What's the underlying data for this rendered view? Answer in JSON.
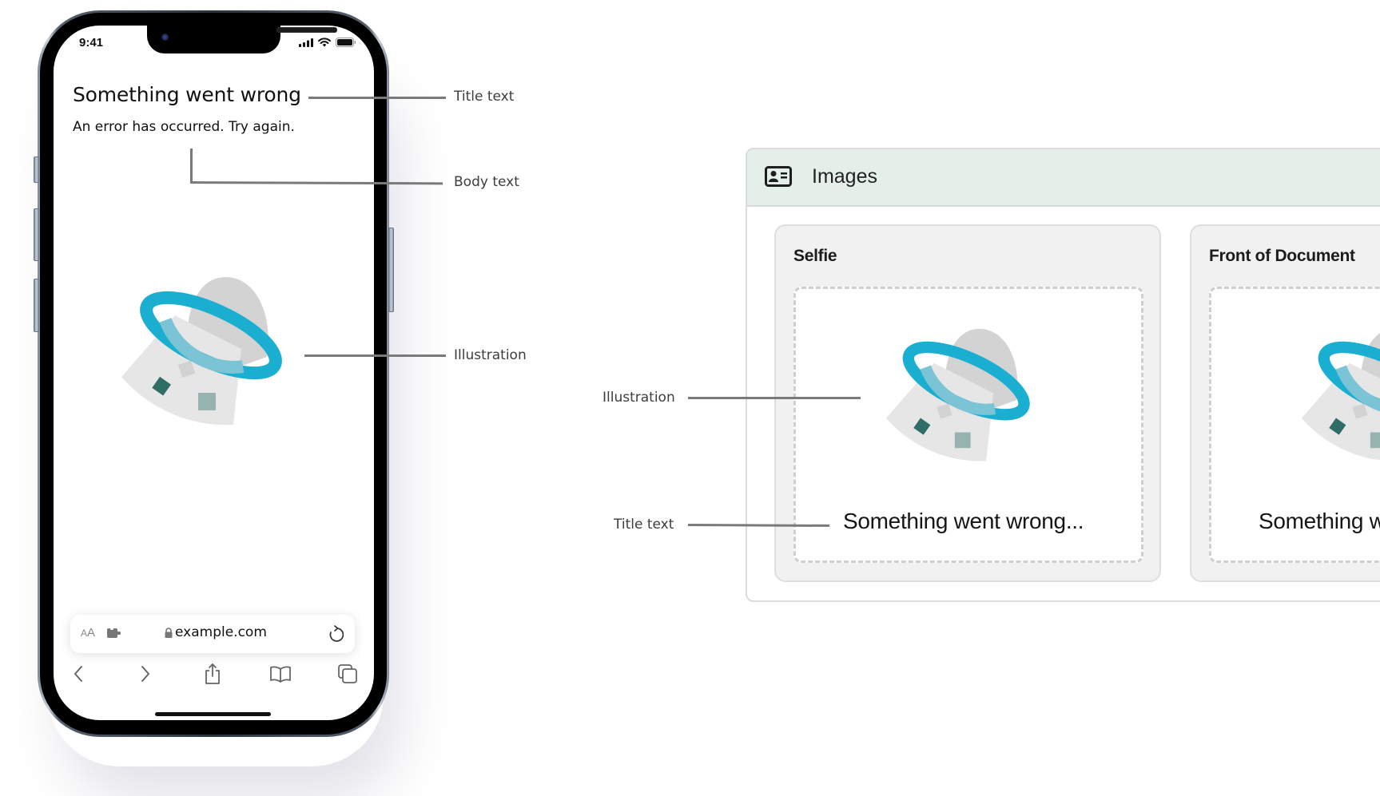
{
  "phone": {
    "status_bar": {
      "time": "9:41",
      "icons": [
        "cellular-signal-icon",
        "wifi-icon",
        "battery-icon"
      ]
    },
    "content": {
      "title": "Something went wrong",
      "body": "An error has occurred. Try again.",
      "illustration": "ufo-error-illustration"
    },
    "browser": {
      "text_size_label_small": "A",
      "text_size_label_large": "A",
      "url": "example.com",
      "toolbar": [
        "back",
        "forward",
        "share",
        "bookmarks",
        "tabs"
      ]
    }
  },
  "phone_annotations": {
    "title": "Title text",
    "body": "Body text",
    "illustration": "Illustration"
  },
  "panel": {
    "title": "Images",
    "cards": [
      {
        "title": "Selfie",
        "message": "Something went wrong..."
      },
      {
        "title": "Front of Document",
        "message": "Something went wrong..."
      }
    ]
  },
  "panel_annotations": {
    "illustration": "Illustration",
    "title": "Title text"
  },
  "colors": {
    "accent_ring": "#1aafd0",
    "header_bg": "#e3efe8",
    "card_bg": "#f1f1f1"
  }
}
